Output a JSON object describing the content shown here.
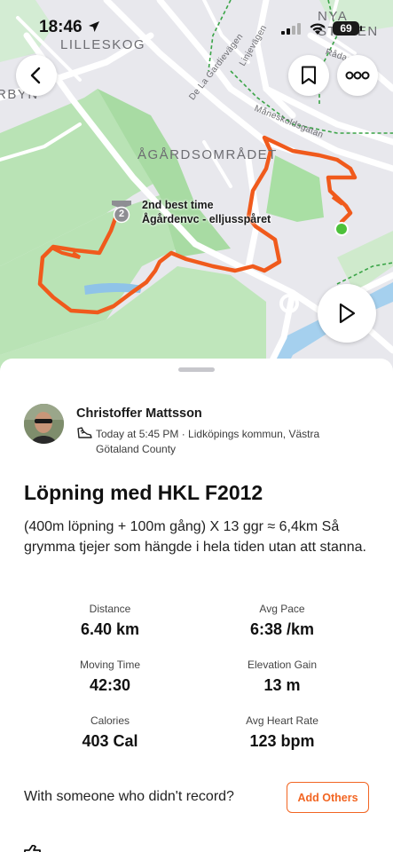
{
  "status_bar": {
    "time": "18:46",
    "battery": "69"
  },
  "map": {
    "labels": {
      "lilleskog": "LILLESKOG",
      "rbyn": "RBYN",
      "agardsomradet": "ÅGÅRDSOMRÅDET",
      "nya_staden": "NYA STADEN",
      "de_la_gardievagen": "De La Gardievägen",
      "linjevagen": "Linjevägen",
      "maneskoldsgatan": "Måneskoldsgatan",
      "radagatan": "Rådagata"
    },
    "segment": {
      "badge": "2",
      "title": "2nd best time",
      "name": "Ågårdenvc - elljusspåret"
    },
    "route_color": "#f05a1c",
    "end_marker_color": "#4cc13a"
  },
  "athlete": {
    "name": "Christoffer Mattsson",
    "meta": "Today at 5:45 PM · Lidköpings kommun, Västra Götaland County"
  },
  "activity": {
    "title": "Löpning med HKL F2012",
    "description": "(400m löpning + 100m gång) X 13 ggr ≈ 6,4km Så grymma tjejer som hängde i hela tiden utan att stanna."
  },
  "stats": [
    {
      "label": "Distance",
      "value": "6.40 km"
    },
    {
      "label": "Avg Pace",
      "value": "6:38 /km"
    },
    {
      "label": "Moving Time",
      "value": "42:30"
    },
    {
      "label": "Elevation Gain",
      "value": "13 m"
    },
    {
      "label": "Calories",
      "value": "403 Cal"
    },
    {
      "label": "Avg Heart Rate",
      "value": "123 bpm"
    }
  ],
  "others": {
    "prompt": "With someone who didn't record?",
    "button": "Add Others"
  },
  "colors": {
    "accent": "#f26522"
  },
  "icons": [
    "location-arrow-icon",
    "signal-icon",
    "wifi-icon",
    "back-chevron-icon",
    "bookmark-icon",
    "more-icon",
    "play-icon",
    "segment-badge-icon",
    "shoe-icon",
    "kudos-icon"
  ]
}
